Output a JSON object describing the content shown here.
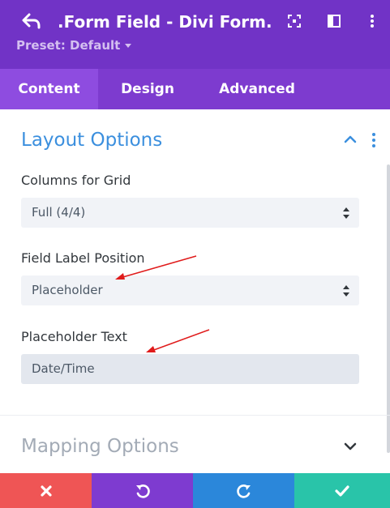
{
  "header": {
    "title": ".Form Field - Divi Form...",
    "preset_label": "Preset: Default",
    "icons": [
      "back-arrow-icon",
      "focus-icon",
      "sidebar-layout-icon",
      "more-icon"
    ]
  },
  "tabs": [
    {
      "label": "Content",
      "active": true
    },
    {
      "label": "Design",
      "active": false
    },
    {
      "label": "Advanced",
      "active": false
    }
  ],
  "sections": {
    "layout": {
      "title": "Layout Options",
      "expanded": true,
      "fields": {
        "columns": {
          "label": "Columns for Grid",
          "value": "Full (4/4)"
        },
        "label_position": {
          "label": "Field Label Position",
          "value": "Placeholder"
        },
        "placeholder_text": {
          "label": "Placeholder Text",
          "value": "Date/Time"
        }
      }
    },
    "mapping": {
      "title": "Mapping Options",
      "expanded": false
    }
  },
  "footer": {
    "buttons": [
      {
        "name": "discard",
        "icon": "close-icon",
        "color": "#ef5555"
      },
      {
        "name": "undo",
        "icon": "undo-icon",
        "color": "#7e3bd0"
      },
      {
        "name": "redo",
        "icon": "redo-icon",
        "color": "#2b87da"
      },
      {
        "name": "save",
        "icon": "check-icon",
        "color": "#29c4a9"
      }
    ]
  },
  "colors": {
    "header_bg": "#7133c6",
    "tab_bar_bg": "#7d3bcf",
    "active_tab_bg": "#8e4ce0",
    "accent_blue": "#3b8fde",
    "annotation_red": "#e01b1b"
  }
}
